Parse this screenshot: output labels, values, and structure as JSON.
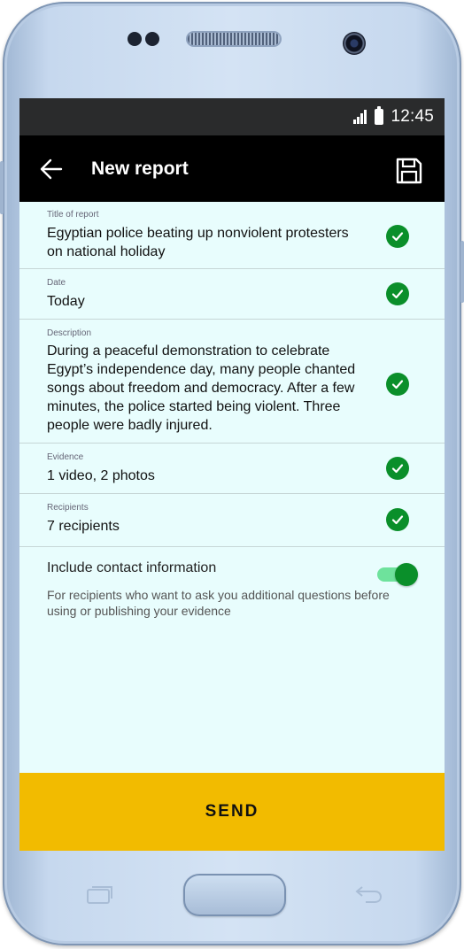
{
  "status_bar": {
    "time": "12:45"
  },
  "app_bar": {
    "title": "New report"
  },
  "fields": [
    {
      "label": "Title of report",
      "value": "Egyptian police beating up nonviolent protesters on national holiday"
    },
    {
      "label": "Date",
      "value": "Today"
    },
    {
      "label": "Description",
      "value": "During a peaceful demonstration to celebrate Egypt’s independence day, many people chanted songs about freedom and democracy. After a few minutes, the police started being violent. Three people were badly injured."
    },
    {
      "label": "Evidence",
      "value": "1 video, 2 photos"
    },
    {
      "label": "Recipients",
      "value": "7 recipients"
    }
  ],
  "contact": {
    "label": "Include contact information",
    "help": "For recipients who want to ask you additional questions before using or publishing your evidence",
    "enabled": true
  },
  "send_button": {
    "label": "SEND"
  },
  "icons": {
    "back": "arrow-left-icon",
    "save": "floppy-disk-icon",
    "check": "check-circle-icon",
    "signal": "signal-icon",
    "battery": "battery-icon"
  },
  "colors": {
    "accent_green": "#0a8f2a",
    "send_yellow": "#f2bb00",
    "screen_bg": "#e8fdfd"
  }
}
